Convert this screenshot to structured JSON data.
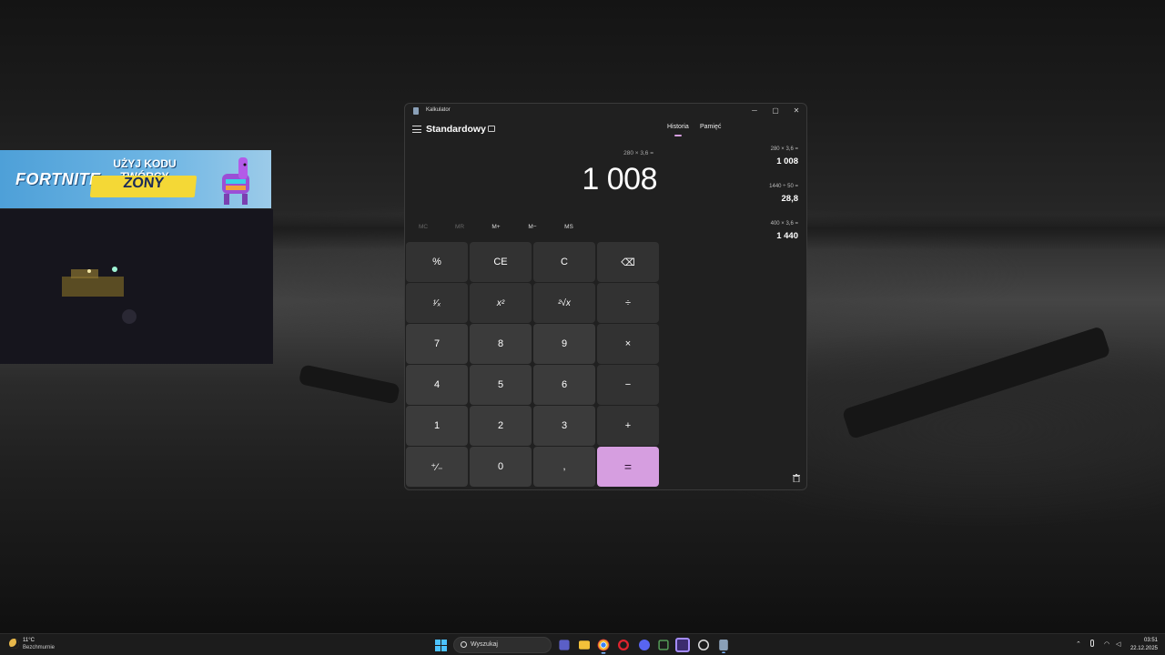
{
  "promo": {
    "brand": "FORTNITE",
    "line1": "UŻYJ KODU TWÓRCY",
    "code": "ZONY"
  },
  "calculator": {
    "window_title": "Kalkulator",
    "mode": "Standardowy",
    "tabs": [
      "Historia",
      "Pamięć"
    ],
    "active_tab": "Historia",
    "expression": "280 × 3,6 =",
    "display": "1 008",
    "memory_buttons": [
      "MC",
      "MR",
      "M+",
      "M−",
      "MS"
    ],
    "keys": [
      "%",
      "CE",
      "C",
      "⌫",
      "¹⁄ₓ",
      "x²",
      "²√x",
      "÷",
      "7",
      "8",
      "9",
      "×",
      "4",
      "5",
      "6",
      "−",
      "1",
      "2",
      "3",
      "+",
      "⁺⁄₋",
      "0",
      ",",
      "="
    ],
    "history": [
      {
        "expression": "280   ×   3,6 =",
        "result": "1 008"
      },
      {
        "expression": "1440   ÷   50 =",
        "result": "28,8"
      },
      {
        "expression": "400   ×   3,6 =",
        "result": "1 440"
      }
    ],
    "accent_color": "#d69ee0"
  },
  "taskbar": {
    "weather_temp": "11°C",
    "weather_desc": "Bezchmurnie",
    "search_placeholder": "Wyszukaj",
    "time": "03:51",
    "date": "22.12.2025"
  }
}
